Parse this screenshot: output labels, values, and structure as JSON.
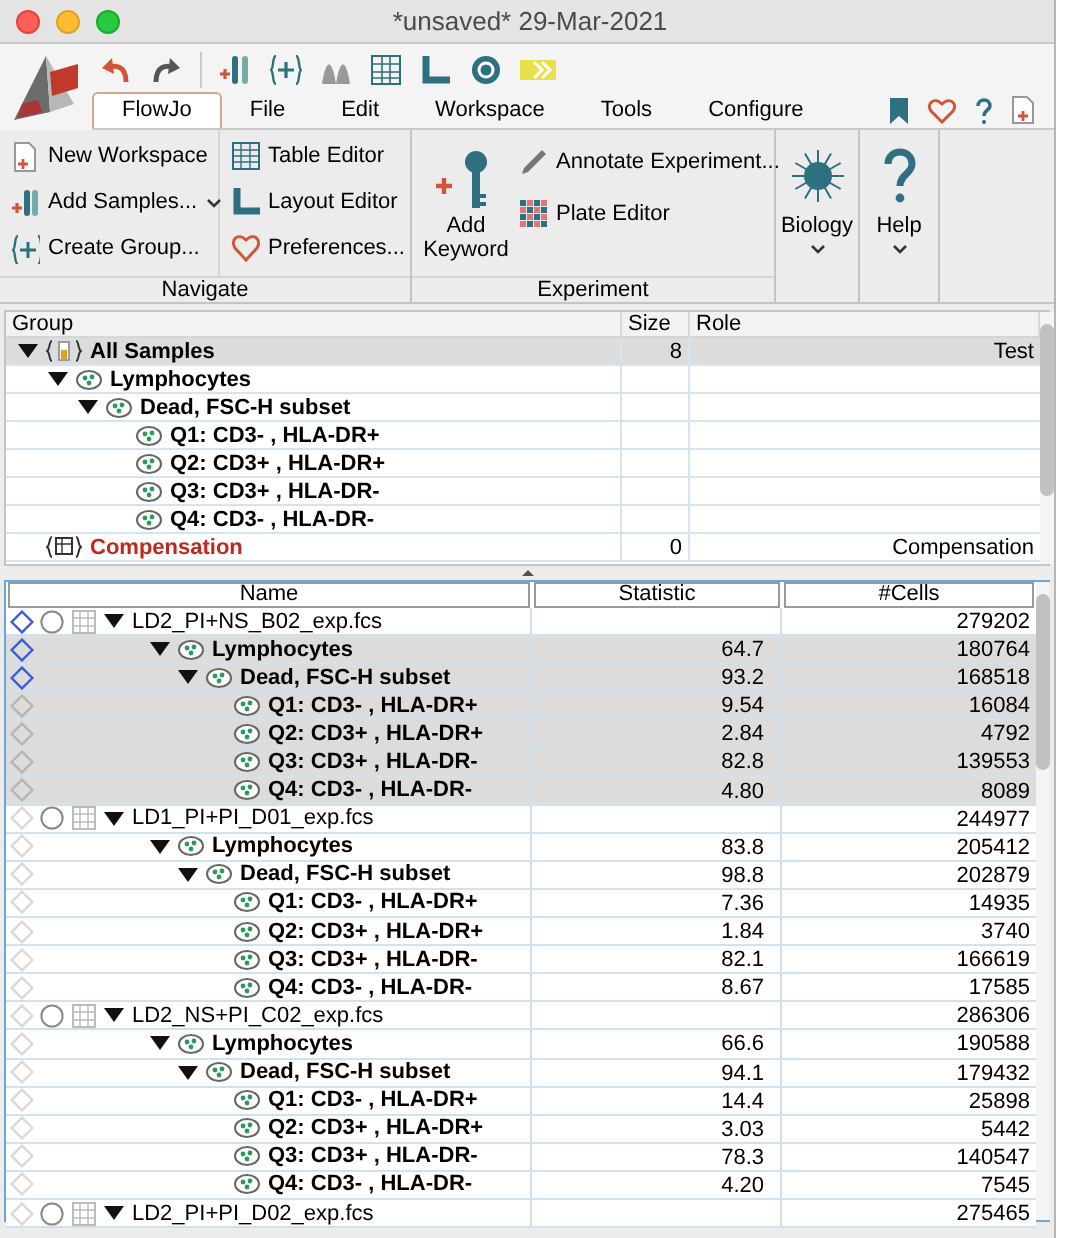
{
  "window": {
    "title": "*unsaved* 29-Mar-2021"
  },
  "menu_tabs": [
    {
      "label": "FlowJo",
      "selected": true
    },
    {
      "label": "File",
      "selected": false
    },
    {
      "label": "Edit",
      "selected": false
    },
    {
      "label": "Workspace",
      "selected": false
    },
    {
      "label": "Tools",
      "selected": false
    },
    {
      "label": "Configure",
      "selected": false
    }
  ],
  "ribbon": {
    "navigate": {
      "label": "Navigate",
      "items": [
        "New Workspace",
        "Add Samples...",
        "Create Group...",
        "Table Editor",
        "Layout Editor",
        "Preferences..."
      ]
    },
    "experiment": {
      "label": "Experiment",
      "large_button": "Add Keyword",
      "items": [
        "Annotate Experiment...",
        "Plate Editor"
      ]
    },
    "biology": "Biology",
    "help": "Help"
  },
  "groups_table": {
    "columns": [
      "Group",
      "Size",
      "Role"
    ],
    "rows": [
      {
        "kind": "group",
        "name": "All Samples",
        "size": "8",
        "role": "Test",
        "selected": true,
        "expanded": true,
        "children": [
          {
            "kind": "gate",
            "name": "Lymphocytes",
            "selected": false,
            "expanded": true,
            "children": [
              {
                "kind": "gate",
                "name": "Dead, FSC-H subset",
                "selected": false,
                "expanded": true,
                "children": [
                  {
                    "kind": "gate",
                    "name": "Q1: CD3- , HLA-DR+",
                    "selected": false
                  },
                  {
                    "kind": "gate",
                    "name": "Q2: CD3+ , HLA-DR+",
                    "selected": false
                  },
                  {
                    "kind": "gate",
                    "name": "Q3: CD3+ , HLA-DR-",
                    "selected": false
                  },
                  {
                    "kind": "gate",
                    "name": "Q4: CD3- , HLA-DR-",
                    "selected": false
                  }
                ]
              }
            ]
          }
        ]
      },
      {
        "kind": "compensation",
        "name": "Compensation",
        "size": "0",
        "role": "Compensation",
        "selected": false
      }
    ]
  },
  "samples_table": {
    "columns": [
      "Name",
      "Statistic",
      "#Cells"
    ],
    "rows": [
      {
        "kind": "sample",
        "name": "LD2_PI+NS_B02_exp.fcs",
        "cells": "279202",
        "selected": false,
        "marked": true,
        "expanded": true,
        "children": [
          {
            "kind": "gate",
            "name": "Lymphocytes",
            "statistic": "64.7",
            "cells": "180764",
            "selected": true,
            "marked": true,
            "expanded": true,
            "children": [
              {
                "kind": "gate",
                "name": "Dead, FSC-H subset",
                "statistic": "93.2",
                "cells": "168518",
                "selected": true,
                "marked": true,
                "expanded": true,
                "children": [
                  {
                    "kind": "gate",
                    "name": "Q1: CD3- , HLA-DR+",
                    "statistic": "9.54",
                    "cells": "16084",
                    "selected": true,
                    "marked": false
                  },
                  {
                    "kind": "gate",
                    "name": "Q2: CD3+ , HLA-DR+",
                    "statistic": "2.84",
                    "cells": "4792",
                    "selected": true,
                    "marked": false
                  },
                  {
                    "kind": "gate",
                    "name": "Q3: CD3+ , HLA-DR-",
                    "statistic": "82.8",
                    "cells": "139553",
                    "selected": true,
                    "marked": false
                  },
                  {
                    "kind": "gate",
                    "name": "Q4: CD3- , HLA-DR-",
                    "statistic": "4.80",
                    "cells": "8089",
                    "selected": true,
                    "marked": false
                  }
                ]
              }
            ]
          }
        ]
      },
      {
        "kind": "sample",
        "name": "LD1_PI+PI_D01_exp.fcs",
        "cells": "244977",
        "selected": false,
        "marked": false,
        "expanded": true,
        "children": [
          {
            "kind": "gate",
            "name": "Lymphocytes",
            "statistic": "83.8",
            "cells": "205412",
            "selected": false,
            "marked": false,
            "expanded": true,
            "children": [
              {
                "kind": "gate",
                "name": "Dead, FSC-H subset",
                "statistic": "98.8",
                "cells": "202879",
                "selected": false,
                "marked": false,
                "expanded": true,
                "children": [
                  {
                    "kind": "gate",
                    "name": "Q1: CD3- , HLA-DR+",
                    "statistic": "7.36",
                    "cells": "14935",
                    "selected": false,
                    "marked": false
                  },
                  {
                    "kind": "gate",
                    "name": "Q2: CD3+ , HLA-DR+",
                    "statistic": "1.84",
                    "cells": "3740",
                    "selected": false,
                    "marked": false
                  },
                  {
                    "kind": "gate",
                    "name": "Q3: CD3+ , HLA-DR-",
                    "statistic": "82.1",
                    "cells": "166619",
                    "selected": false,
                    "marked": false
                  },
                  {
                    "kind": "gate",
                    "name": "Q4: CD3- , HLA-DR-",
                    "statistic": "8.67",
                    "cells": "17585",
                    "selected": false,
                    "marked": false
                  }
                ]
              }
            ]
          }
        ]
      },
      {
        "kind": "sample",
        "name": "LD2_NS+PI_C02_exp.fcs",
        "cells": "286306",
        "selected": false,
        "marked": false,
        "expanded": true,
        "children": [
          {
            "kind": "gate",
            "name": "Lymphocytes",
            "statistic": "66.6",
            "cells": "190588",
            "selected": false,
            "marked": false,
            "expanded": true,
            "children": [
              {
                "kind": "gate",
                "name": "Dead, FSC-H subset",
                "statistic": "94.1",
                "cells": "179432",
                "selected": false,
                "marked": false,
                "expanded": true,
                "children": [
                  {
                    "kind": "gate",
                    "name": "Q1: CD3- , HLA-DR+",
                    "statistic": "14.4",
                    "cells": "25898",
                    "selected": false,
                    "marked": false
                  },
                  {
                    "kind": "gate",
                    "name": "Q2: CD3+ , HLA-DR+",
                    "statistic": "3.03",
                    "cells": "5442",
                    "selected": false,
                    "marked": false
                  },
                  {
                    "kind": "gate",
                    "name": "Q3: CD3+ , HLA-DR-",
                    "statistic": "78.3",
                    "cells": "140547",
                    "selected": false,
                    "marked": false
                  },
                  {
                    "kind": "gate",
                    "name": "Q4: CD3- , HLA-DR-",
                    "statistic": "4.20",
                    "cells": "7545",
                    "selected": false,
                    "marked": false
                  }
                ]
              }
            ]
          }
        ]
      },
      {
        "kind": "sample",
        "name": "LD2_PI+PI_D02_exp.fcs",
        "cells": "275465",
        "selected": false,
        "marked": false,
        "expanded": true
      }
    ]
  }
}
